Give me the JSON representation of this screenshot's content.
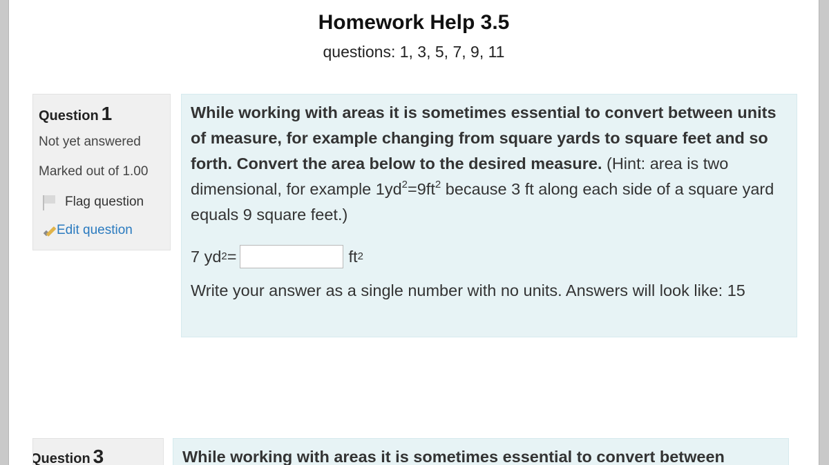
{
  "page": {
    "title": "Homework Help 3.5",
    "subtitle": "questions: 1, 3, 5, 7, 9, 11"
  },
  "question1": {
    "label": "Question",
    "number": "1",
    "state": "Not yet answered",
    "grade": "Marked out of 1.00",
    "flag_label": "Flag question",
    "edit_label": "Edit question",
    "text_bold": "While working with areas it is sometimes essential to convert between units of measure, for example changing from square yards to square feet and so forth.  Convert the area below to the desired measure.",
    "hint_prefix": " (Hint: area is two dimensional, for example 1yd",
    "hint_exp1": "2",
    "hint_mid": "=9ft",
    "hint_exp2": "2",
    "hint_suffix": " because 3 ft along each side of a square yard equals 9 square feet.)",
    "prompt_prefix": "7 yd",
    "prompt_exp": "2",
    "prompt_eq": "=",
    "answer_value": "",
    "unit_base": "ft",
    "unit_exp": "2",
    "instructions": "Write your answer as a single number with no units. Answers will look like: 15"
  },
  "question3": {
    "label": "Question",
    "number": "3",
    "text_bold": "While working with areas it is sometimes essential to convert between"
  },
  "colors": {
    "content_bg": "#e7f3f5",
    "info_bg": "#f0f0f0",
    "link": "#2a7abf"
  },
  "icons": [
    "flag-icon",
    "edit-icon"
  ]
}
